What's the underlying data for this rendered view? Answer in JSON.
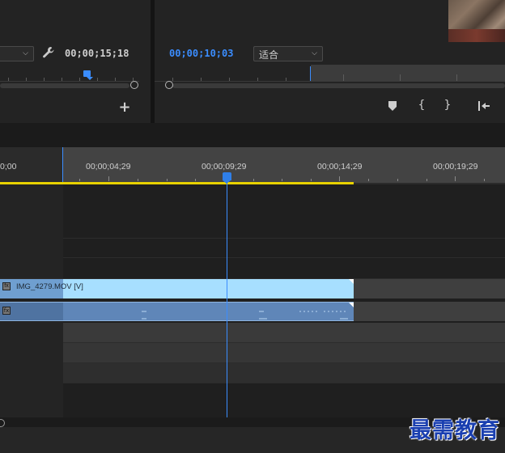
{
  "source_monitor": {
    "timecode": "00;00;15;18",
    "wrench_icon": "wrench-icon",
    "add_icon": "plus-icon"
  },
  "program_monitor": {
    "timecode": "00;00;10;03",
    "fit_dropdown": "适合",
    "controls": [
      "marker-icon",
      "mark-in-icon",
      "mark-out-icon",
      "go-to-in-icon"
    ]
  },
  "timeline": {
    "ruler_labels": [
      "0;00",
      "00;00;04;29",
      "00;00;09;29",
      "00;00;14;29",
      "00;00;19;29"
    ],
    "video_clip_name": "IMG_4279.MOV [V]",
    "fx_badge": "fx"
  },
  "watermark": "最需教育",
  "colors": {
    "accent_blue": "#3b8dff",
    "render_bar_yellow": "#e8d200",
    "video_clip": "#a7dfff",
    "audio_clip": "#5f86b8"
  }
}
